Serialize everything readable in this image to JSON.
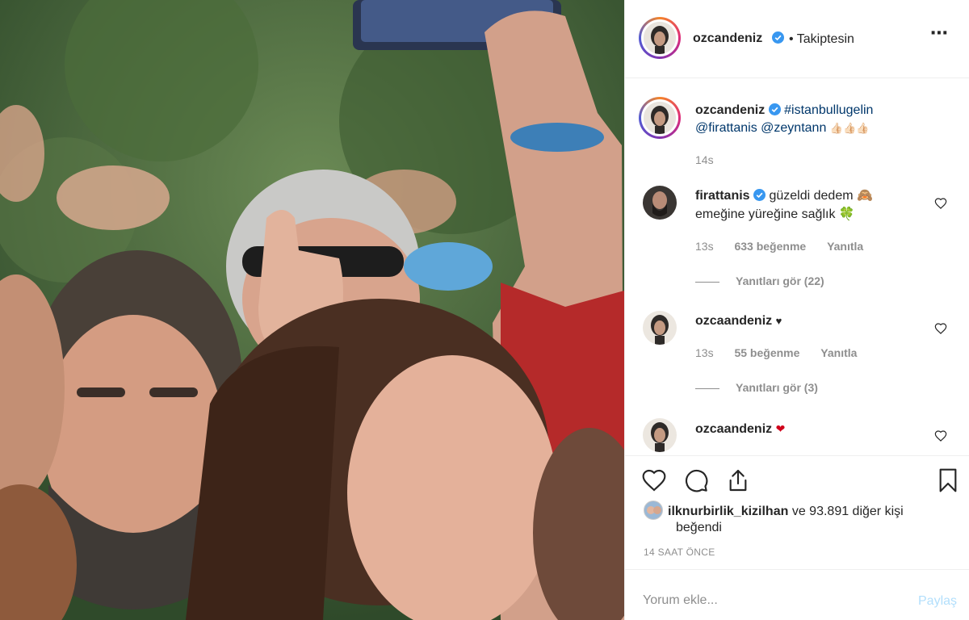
{
  "post": {
    "username": "ozcandeniz",
    "follow_status": "• Takiptesin",
    "more_icon": "more-horizontal-icon"
  },
  "caption": {
    "username": "ozcandeniz",
    "hashtag": "#istanbullugelin",
    "mentions": "@firattanis @zeyntann",
    "emoji": "👍🏻👍🏻👍🏻",
    "time": "14s"
  },
  "comments": [
    {
      "username": "firattanis",
      "verified": true,
      "text_line1": "güzeldi dedem",
      "emoji1": "🙈",
      "text_line2": "emeğine yüreğine sağlık",
      "emoji2": "🍀",
      "time": "13s",
      "likes": "633 beğenme",
      "reply": "Yanıtla",
      "view_replies": "Yanıtları gör (22)"
    },
    {
      "username": "ozcaandeniz",
      "text": "♥",
      "time": "13s",
      "likes": "55 beğenme",
      "reply": "Yanıtla",
      "view_replies": "Yanıtları gör (3)"
    },
    {
      "username": "ozcaandeniz",
      "text": "❤"
    }
  ],
  "likes": {
    "first_user": "ilknurbirlik_kizilhan",
    "rest": "ve 93.891 diğer kişi",
    "line2": "beğendi"
  },
  "timestamp": "14 SAAT ÖNCE",
  "comment_box": {
    "placeholder": "Yorum ekle...",
    "share": "Paylaş"
  },
  "colors": {
    "verified": "#3897f0",
    "link": "#00376b",
    "muted": "#8e8e8e",
    "heart_red": "#ed4956",
    "share_disabled": "#b2dffc"
  }
}
